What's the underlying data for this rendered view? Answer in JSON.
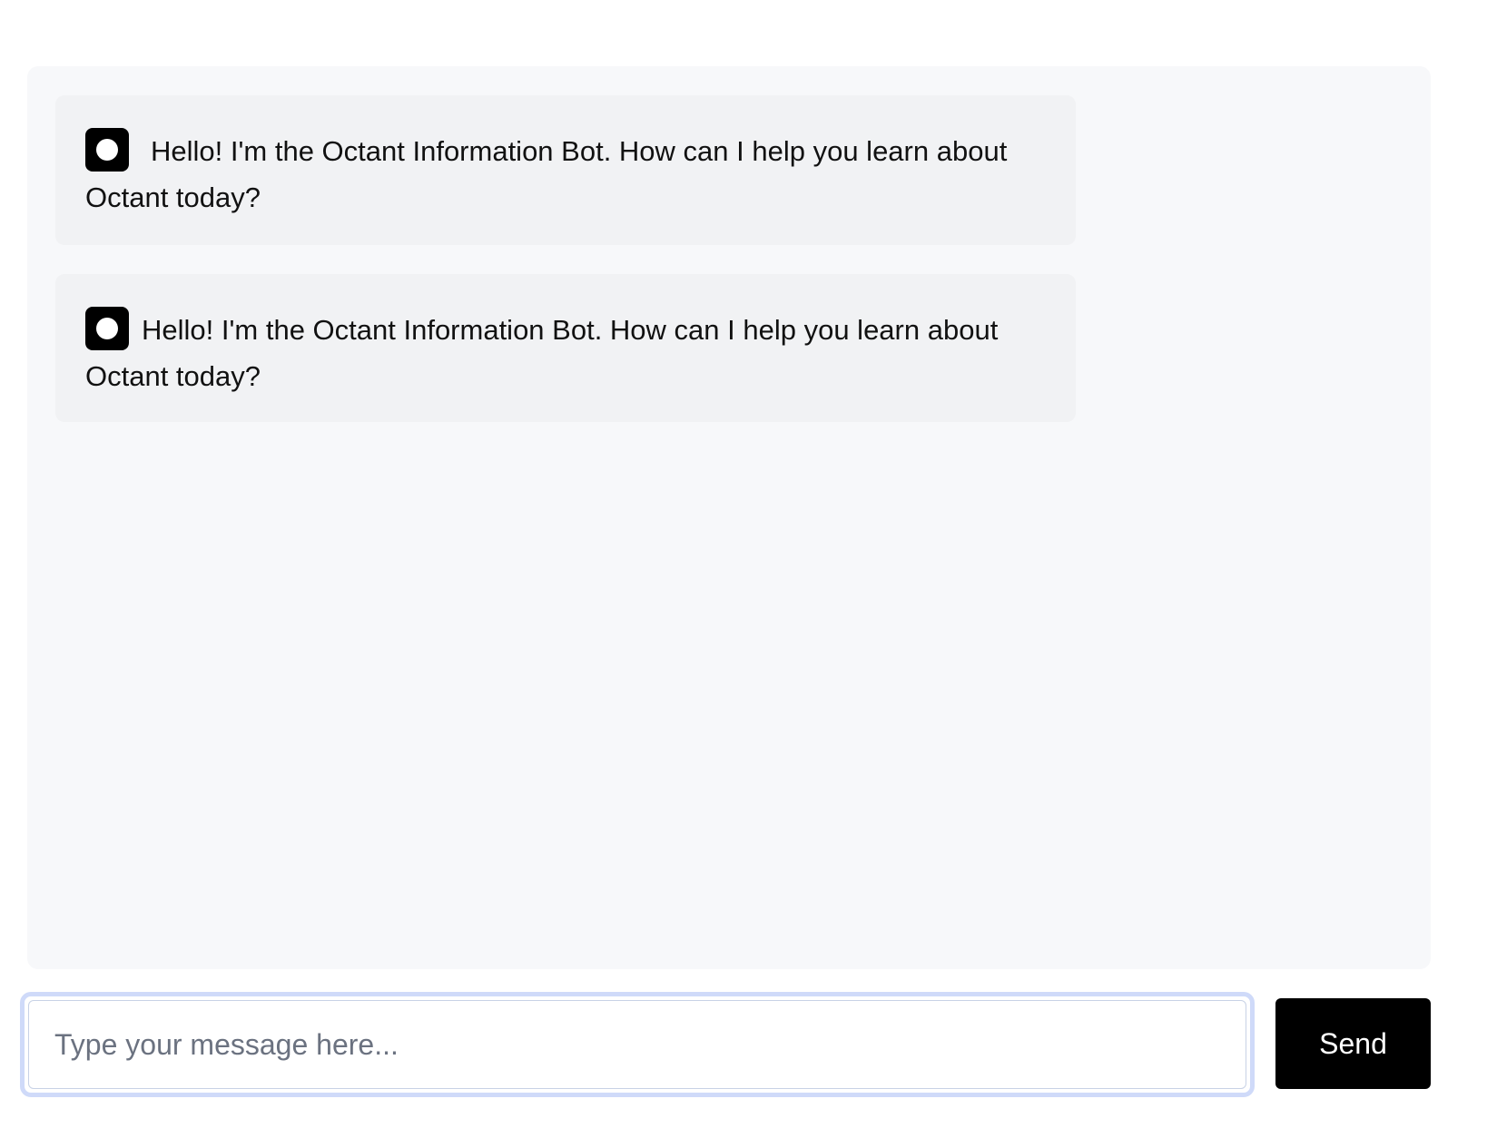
{
  "chat": {
    "messages": [
      {
        "sender_icon": "bot-icon",
        "text": "Hello! I'm the Octant Information Bot. How can I help you learn about Octant today?"
      },
      {
        "sender_icon": "bot-icon",
        "text": "Hello! I'm the Octant Information Bot. How can I help you learn about Octant today?"
      }
    ]
  },
  "composer": {
    "placeholder": "Type your message here...",
    "value": "",
    "send_label": "Send"
  },
  "colors": {
    "panel_background": "#f7f8fa",
    "message_background": "#f1f2f4",
    "input_focus_ring": "#cfdaf9",
    "send_button": "#000000"
  }
}
